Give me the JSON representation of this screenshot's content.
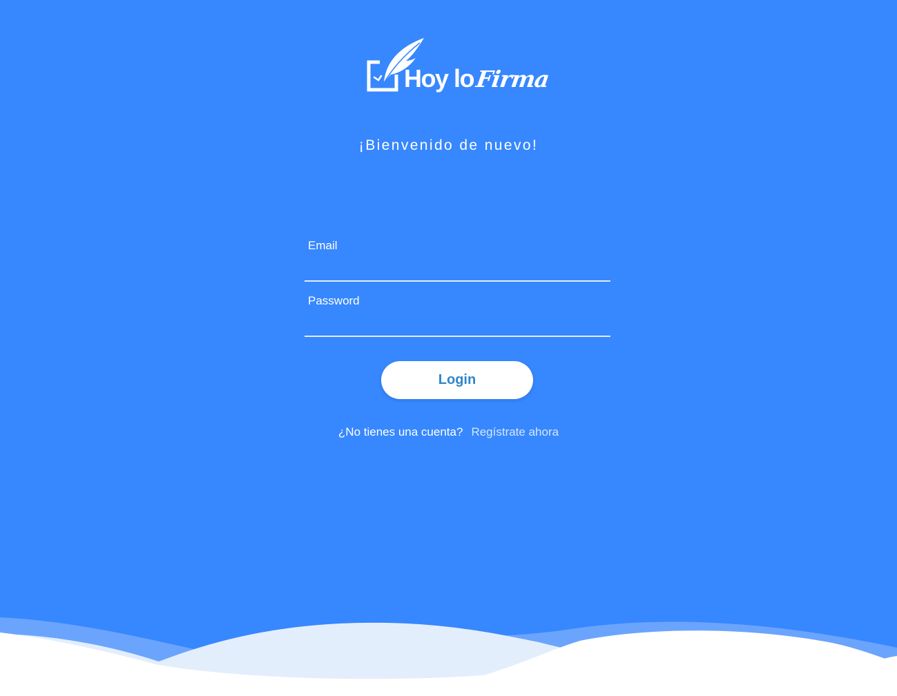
{
  "brand": {
    "name_part1": "Hoy lo",
    "name_part2": "Firma"
  },
  "welcome_text": "¡Bienvenido de nuevo!",
  "form": {
    "email_label": "Email",
    "email_value": "",
    "password_label": "Password",
    "password_value": ""
  },
  "login_button_label": "Login",
  "signup": {
    "question": "¿No tienes una cuenta?",
    "link_label": "Regístrate ahora"
  },
  "colors": {
    "background": "#3787fe",
    "button_text": "#2f86c9",
    "wave_light": "#e3eefd",
    "wave_mid": "#6aa4fd"
  }
}
